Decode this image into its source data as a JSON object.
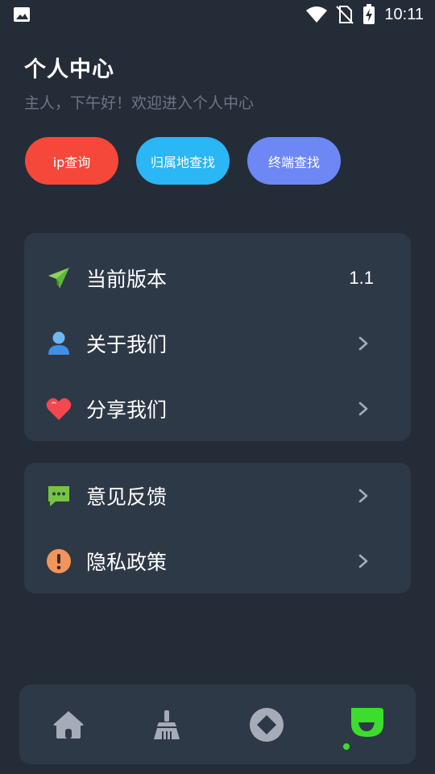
{
  "status_bar": {
    "time": "10:11",
    "icons": [
      "image-icon",
      "wifi-icon",
      "no-sim-icon",
      "battery-charging-icon"
    ]
  },
  "header": {
    "title": "个人中心",
    "subtitle": "主人，下午好！欢迎进入个人中心"
  },
  "actions": [
    {
      "label": "ip查询",
      "color": "#f5483b"
    },
    {
      "label": "归属地查找",
      "color": "#2bb6f5"
    },
    {
      "label": "终端查找",
      "color": "#6d87f5"
    }
  ],
  "card1": {
    "items": [
      {
        "icon": "paper-plane-icon",
        "label": "当前版本",
        "value": "1.1"
      },
      {
        "icon": "user-icon",
        "label": "关于我们"
      },
      {
        "icon": "heart-icon",
        "label": "分享我们"
      }
    ]
  },
  "card2": {
    "items": [
      {
        "icon": "chat-bubble-icon",
        "label": "意见反馈"
      },
      {
        "icon": "warning-icon",
        "label": "隐私政策"
      }
    ]
  },
  "bottom_nav": {
    "items": [
      {
        "icon": "home-icon",
        "active": false
      },
      {
        "icon": "broom-icon",
        "active": false
      },
      {
        "icon": "diamond-icon",
        "active": false
      },
      {
        "icon": "profile-icon",
        "active": true
      }
    ],
    "active_color": "#3ddc2e",
    "inactive_color": "#a5acb8"
  }
}
